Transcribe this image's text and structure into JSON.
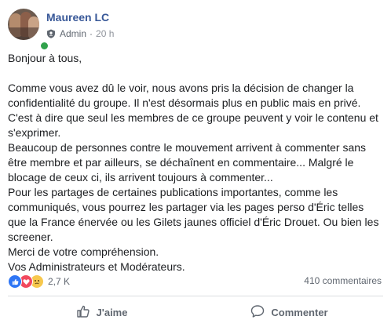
{
  "post": {
    "author": "Maureen LC",
    "role": "Admin",
    "separator": "·",
    "time": "20 h",
    "paragraphs": [
      "Bonjour à tous,",
      "Comme vous avez dû le voir, nous avons pris la décision de changer la confidentialité du groupe. Il n'est désormais plus en public mais en privé.",
      "C'est à dire que seul les membres de ce groupe peuvent y voir le contenu et s'exprimer.",
      "Beaucoup de personnes contre le mouvement arrivent à commenter sans être membre et par ailleurs, se déchaînent en commentaire... Malgré le blocage de ceux ci, ils arrivent toujours à commenter...",
      "Pour les partages de certaines publications importantes, comme les communiqués, vous pourrez les partager via les pages perso d'Éric telles que la France énervée ou les Gilets jaunes officiel d'Éric Drouet. Ou bien les screener.",
      "Merci de votre compréhension.",
      "Vos Administrateurs et Modérateurs."
    ]
  },
  "reactions": {
    "types": [
      "like-icon",
      "love-icon",
      "sad-icon"
    ],
    "count": "2,7 K",
    "comments": "410 commentaires"
  },
  "actions": {
    "like_label": "J'aime",
    "comment_label": "Commenter"
  },
  "colors": {
    "author": "#385898",
    "like": "#2f76f5",
    "love": "#f2495e",
    "sad": "#f7c84d",
    "online": "#31a24c"
  }
}
